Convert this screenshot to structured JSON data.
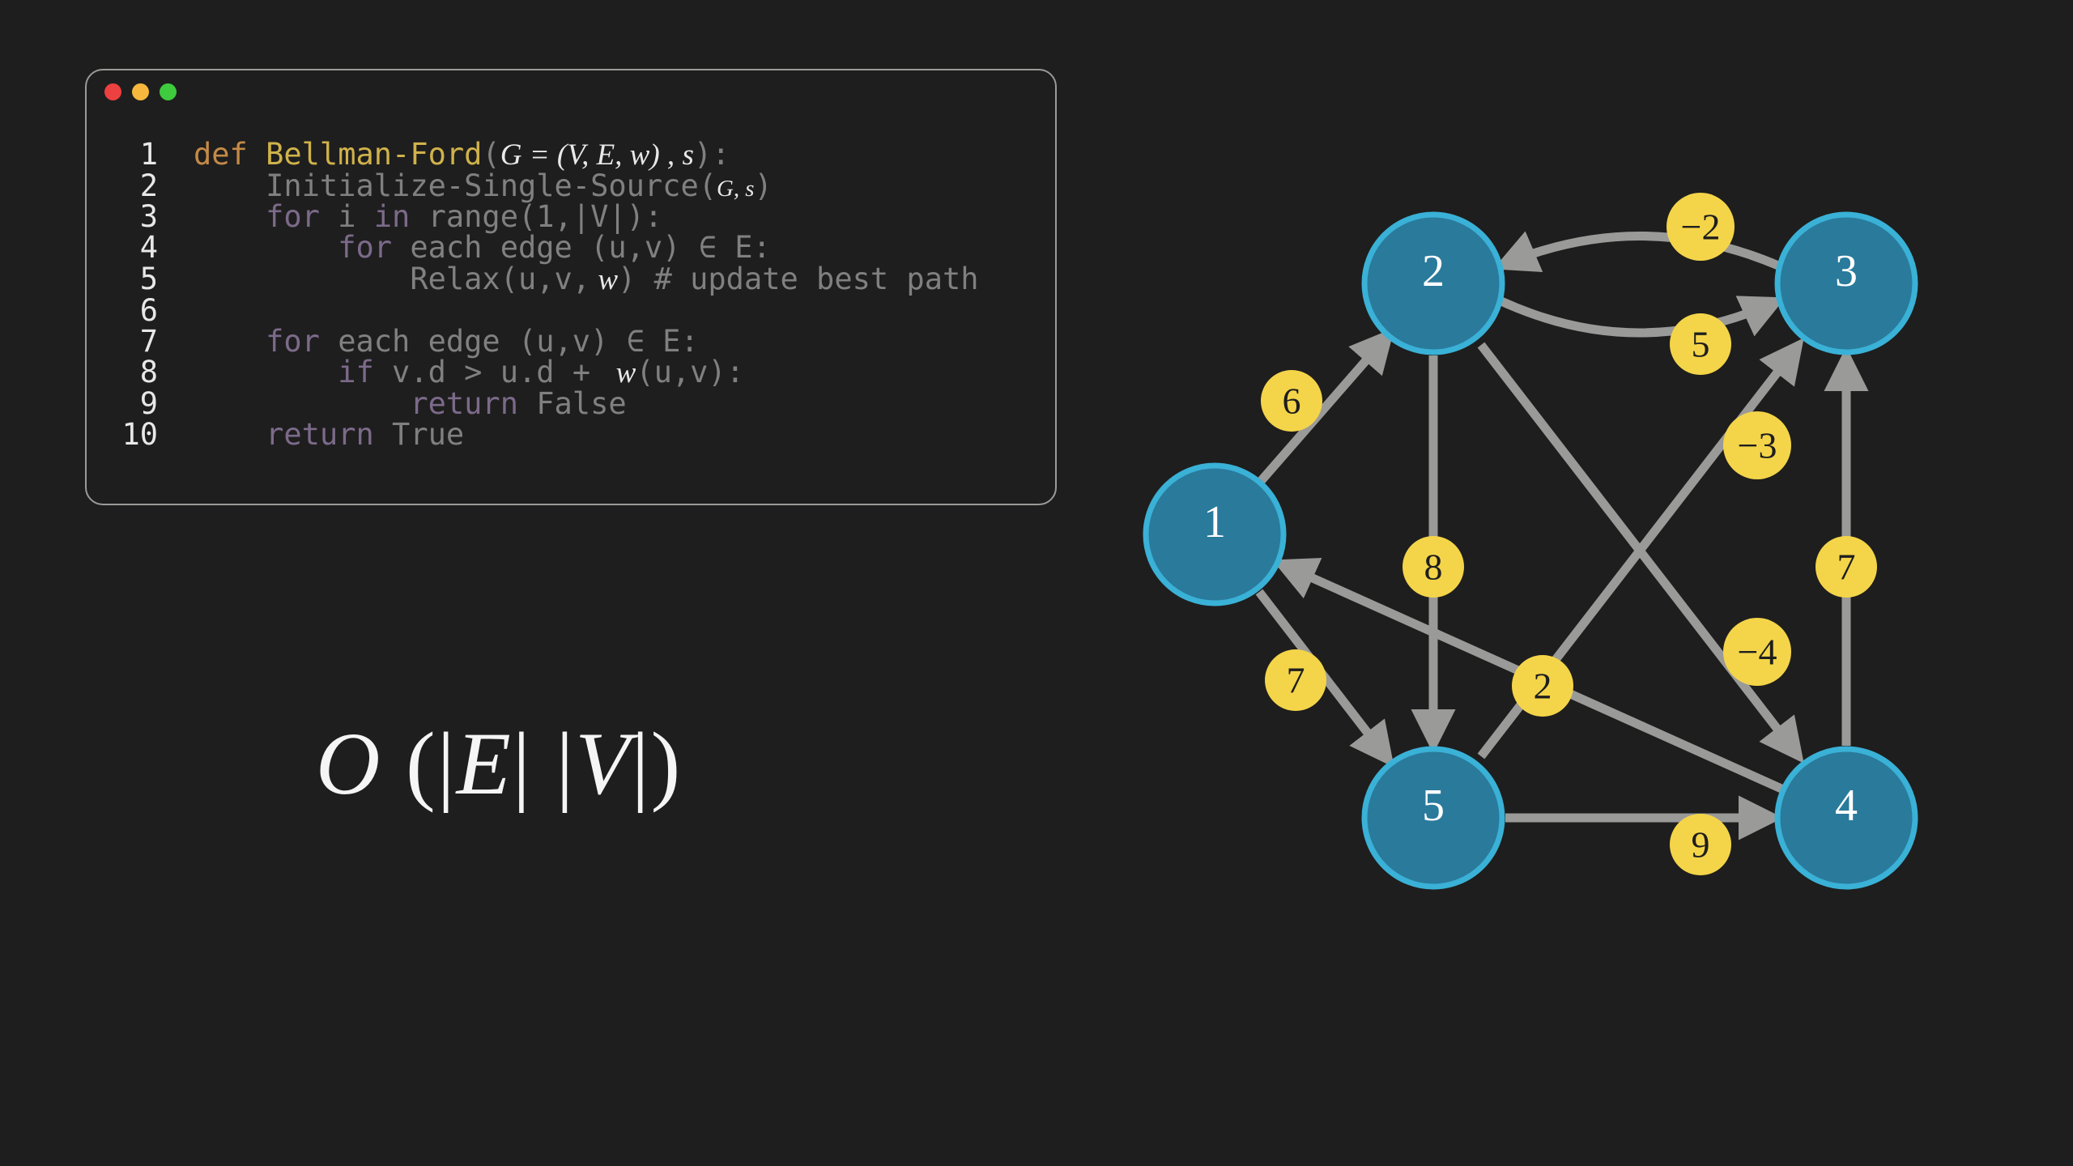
{
  "code": {
    "line_numbers": [
      "1",
      "2",
      "3",
      "4",
      "5",
      "6",
      "7",
      "8",
      "9",
      "10"
    ],
    "l1_def": "def ",
    "l1_fn": "Bellman-Ford",
    "l1_open": "(",
    "l1_sig1": "G",
    "l1_sig_eq": " = (",
    "l1_sig2": "V, E, w",
    "l1_sig_close": ") , ",
    "l1_sig3": "s",
    "l1_close": "):",
    "l2": "Initialize-Single-Source(",
    "l2_args": "G, s",
    "l2_close": ")",
    "l3_for": "for",
    "l3_mid": " i ",
    "l3_in": "in",
    "l3_range": " range",
    "l3_args": "(1,|V|):",
    "l4_for": "for",
    "l4_rest": " each edge (u,v) ∈ E:",
    "l5_call": "Relax(u,v,",
    "l5_w": " w",
    "l5_close": ")",
    "l5_comment": " # update best path",
    "l7_for": "for",
    "l7_rest": " each edge (u,v) ∈ E:",
    "l8_if": "if",
    "l8_cond1": " v.d > u.d + ",
    "l8_w": " w",
    "l8_cond2": "(u,v):",
    "l9_ret": "return",
    "l9_val": " False",
    "l10_ret": "return",
    "l10_val": " True"
  },
  "complexity": {
    "O": "O ",
    "open": "(",
    "bar1": "|",
    "E": "E",
    "bar2": "| |",
    "V": "V",
    "bar3": "|",
    "close": ")"
  },
  "graph": {
    "nodes": [
      {
        "id": "1",
        "label": "1"
      },
      {
        "id": "2",
        "label": "2"
      },
      {
        "id": "3",
        "label": "3"
      },
      {
        "id": "4",
        "label": "4"
      },
      {
        "id": "5",
        "label": "5"
      }
    ],
    "edges": [
      {
        "from": "1",
        "to": "2",
        "weight": "6"
      },
      {
        "from": "1",
        "to": "5",
        "weight": "7"
      },
      {
        "from": "2",
        "to": "3",
        "weight": "5"
      },
      {
        "from": "2",
        "to": "4",
        "weight": "−4"
      },
      {
        "from": "2",
        "to": "5",
        "weight": "8"
      },
      {
        "from": "3",
        "to": "2",
        "weight": "−2"
      },
      {
        "from": "4",
        "to": "3",
        "weight": "7"
      },
      {
        "from": "4",
        "to": "1",
        "weight": "2"
      },
      {
        "from": "5",
        "to": "4",
        "weight": "9"
      },
      {
        "from": "5",
        "to": "3",
        "weight": "−3"
      }
    ]
  }
}
